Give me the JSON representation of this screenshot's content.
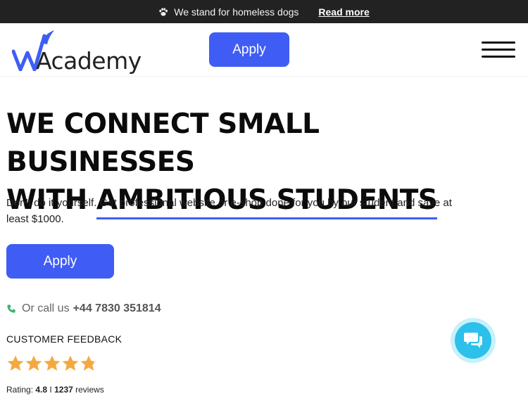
{
  "announcement": {
    "icon": "paw-icon",
    "message": "We stand for homeless dogs",
    "link_text": "Read more"
  },
  "header": {
    "logo_text": "Academy",
    "logo_mark": "W",
    "apply_label": "Apply",
    "menu_icon": "hamburger-menu-icon"
  },
  "hero": {
    "title_line1": "WE CONNECT SMALL BUSINESSES",
    "title_line2_prefix": "WITH ",
    "title_line2_highlight": "AMBITIOUS STUDENTS",
    "subtitle": "Don’t do it yourself. Get professional website or e-shop done for you by our student and save at least $1000.",
    "apply_label": "Apply"
  },
  "contact": {
    "icon": "phone-icon",
    "prefix": "Or call us",
    "phone": "+44 7830 351814"
  },
  "feedback": {
    "label": "CUSTOMER FEEDBACK",
    "stars": 4.8,
    "rating_prefix": "Rating:",
    "rating_value": "4.8",
    "separator": "I",
    "reviews_count": "1237",
    "reviews_label": "reviews"
  },
  "chat": {
    "icon": "chat-bubbles-icon"
  },
  "colors": {
    "accent": "#3f5df5",
    "topbar_bg": "#222222",
    "star": "#f4a940",
    "chat": "#2cc0ea",
    "phone": "#3cb371"
  }
}
